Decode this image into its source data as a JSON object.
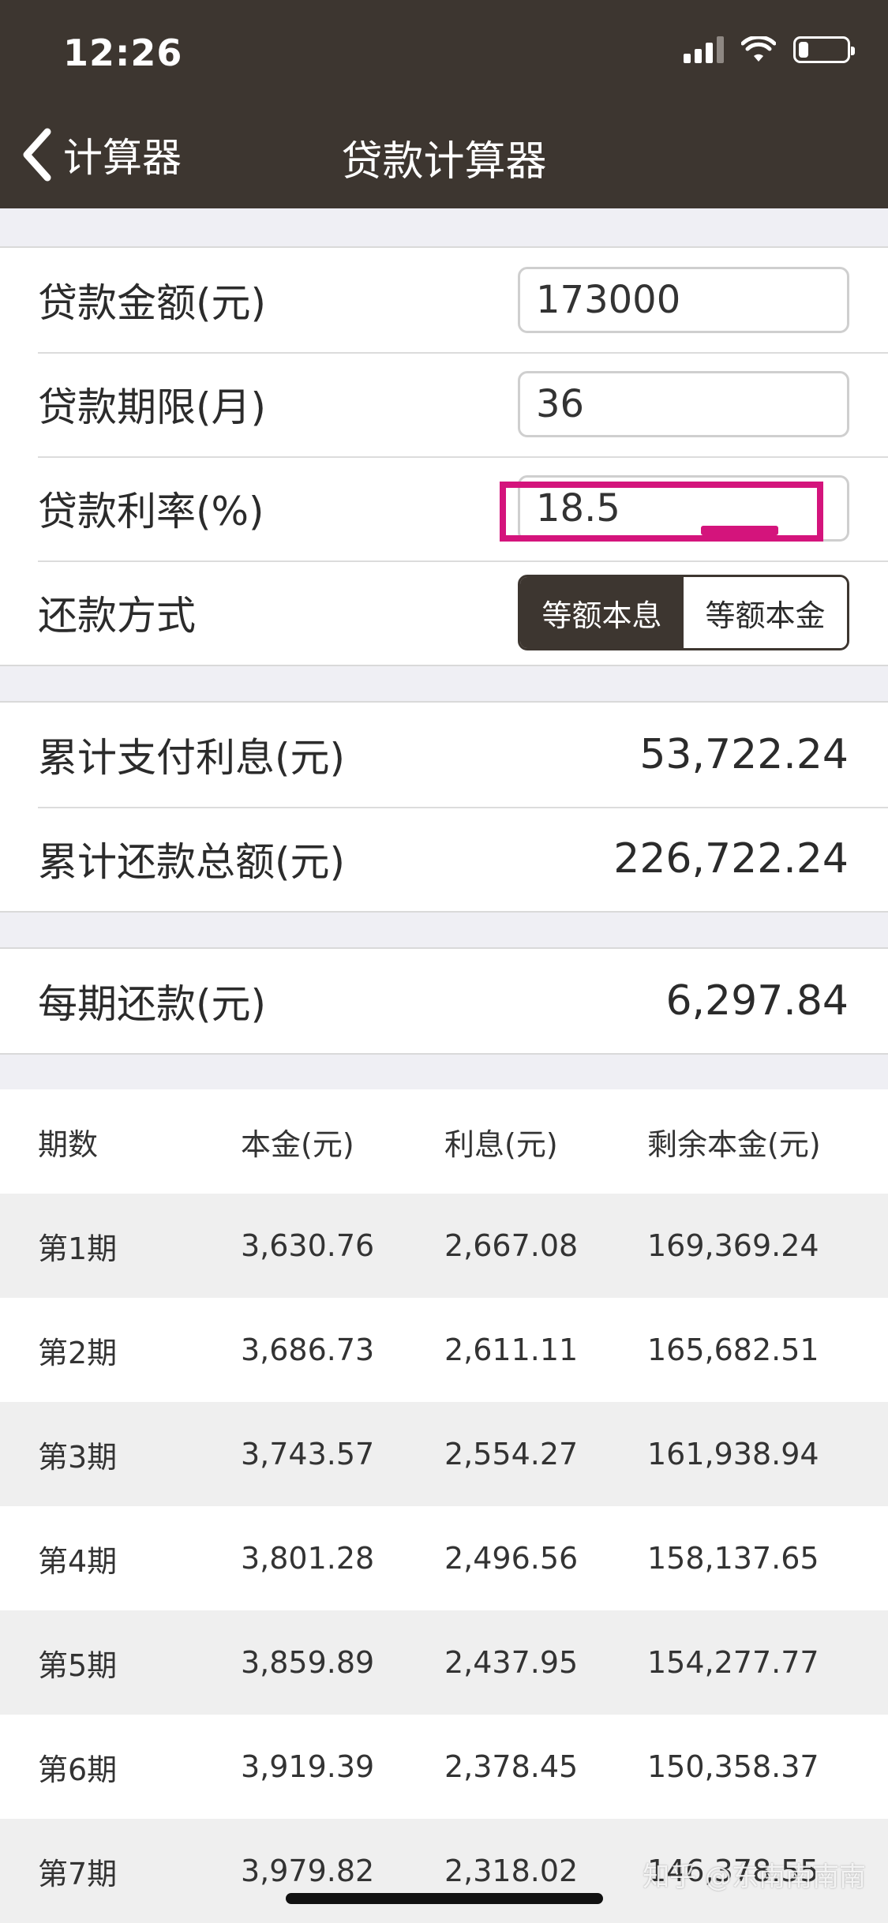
{
  "status_bar": {
    "time": "12:26"
  },
  "nav": {
    "back_label": "计算器",
    "title": "贷款计算器"
  },
  "inputs": {
    "amount_label": "贷款金额(元)",
    "amount_value": "173000",
    "term_label": "贷款期限(月)",
    "term_value": "36",
    "rate_label": "贷款利率(%)",
    "rate_value": "18.5"
  },
  "repayment": {
    "label": "还款方式",
    "options": [
      "等额本息",
      "等额本金"
    ],
    "selected": "等额本息"
  },
  "summary": {
    "total_interest_label": "累计支付利息(元)",
    "total_interest_value": "53,722.24",
    "total_payment_label": "累计还款总额(元)",
    "total_payment_value": "226,722.24"
  },
  "monthly": {
    "label": "每期还款(元)",
    "value": "6,297.84"
  },
  "table": {
    "headers": [
      "期数",
      "本金(元)",
      "利息(元)",
      "剩余本金(元)"
    ],
    "rows": [
      [
        "第1期",
        "3,630.76",
        "2,667.08",
        "169,369.24"
      ],
      [
        "第2期",
        "3,686.73",
        "2,611.11",
        "165,682.51"
      ],
      [
        "第3期",
        "3,743.57",
        "2,554.27",
        "161,938.94"
      ],
      [
        "第4期",
        "3,801.28",
        "2,496.56",
        "158,137.65"
      ],
      [
        "第5期",
        "3,859.89",
        "2,437.95",
        "154,277.77"
      ],
      [
        "第6期",
        "3,919.39",
        "2,378.45",
        "150,358.37"
      ],
      [
        "第7期",
        "3,979.82",
        "2,318.02",
        "146,378.55"
      ]
    ]
  },
  "watermark": "知乎 @东南南南南",
  "colors": {
    "header_bg": "#3d3630",
    "highlight": "#d4147c",
    "row_shade": "#efefef"
  },
  "icons": {
    "back": "chevron-left-icon",
    "signal": "signal-icon",
    "wifi": "wifi-icon",
    "battery": "battery-icon"
  },
  "battery_level": 0.2
}
